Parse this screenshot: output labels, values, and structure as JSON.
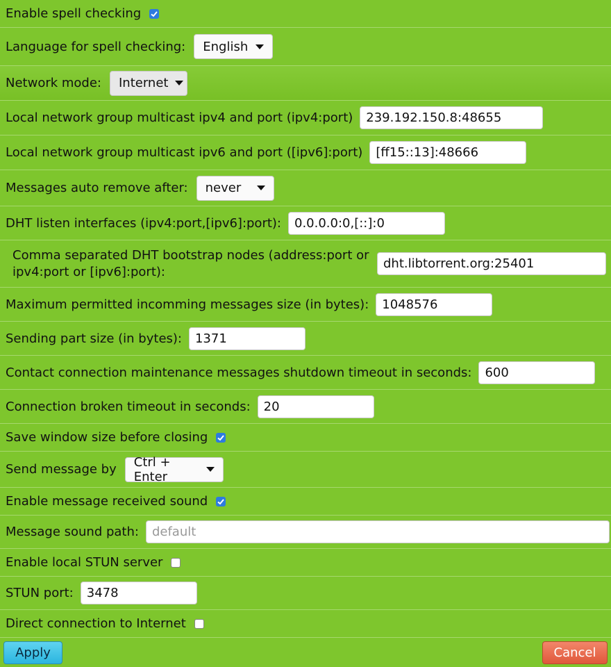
{
  "settings": {
    "spell_check": {
      "label": "Enable spell checking",
      "checked": true
    },
    "spell_language": {
      "label": "Language for spell checking:",
      "value": "English"
    },
    "network_mode": {
      "label": "Network mode:",
      "value": "Internet"
    },
    "ipv4_multicast": {
      "label": "Local network group multicast ipv4 and port (ipv4:port)",
      "value": "239.192.150.8:48655"
    },
    "ipv6_multicast": {
      "label": "Local network group multicast ipv6 and port ([ipv6]:port)",
      "value": "[ff15::13]:48666"
    },
    "auto_remove": {
      "label": "Messages auto remove after:",
      "value": "never"
    },
    "dht_interfaces": {
      "label": "DHT listen interfaces (ipv4:port,[ipv6]:port):",
      "value": "0.0.0.0:0,[::]:0"
    },
    "dht_bootstrap": {
      "label": "Comma separated DHT bootstrap nodes (address:port or ipv4:port or [ipv6]:port):",
      "value": "dht.libtorrent.org:25401"
    },
    "max_msg_size": {
      "label": "Maximum permitted incomming messages size (in bytes):",
      "value": "1048576"
    },
    "part_size": {
      "label": "Sending part size (in bytes):",
      "value": "1371"
    },
    "maint_timeout": {
      "label": "Contact connection maintenance messages shutdown timeout in seconds:",
      "value": "600"
    },
    "broken_timeout": {
      "label": "Connection broken timeout in seconds:",
      "value": "20"
    },
    "save_window": {
      "label": "Save window size before closing",
      "checked": true
    },
    "send_by": {
      "label": "Send message by",
      "value": "Ctrl + Enter"
    },
    "recv_sound": {
      "label": "Enable message received sound",
      "checked": true
    },
    "sound_path": {
      "label": "Message sound path:",
      "value": "",
      "placeholder": "default"
    },
    "local_stun": {
      "label": "Enable local STUN server",
      "checked": false
    },
    "stun_port": {
      "label": "STUN port:",
      "value": "3478"
    },
    "direct_conn": {
      "label": "Direct connection to Internet",
      "checked": false
    }
  },
  "buttons": {
    "apply": "Apply",
    "cancel": "Cancel"
  },
  "colors": {
    "background": "#7ec62d",
    "checkbox_on": "#2d7be0",
    "apply": "#2bb5df",
    "cancel": "#e0583b"
  }
}
